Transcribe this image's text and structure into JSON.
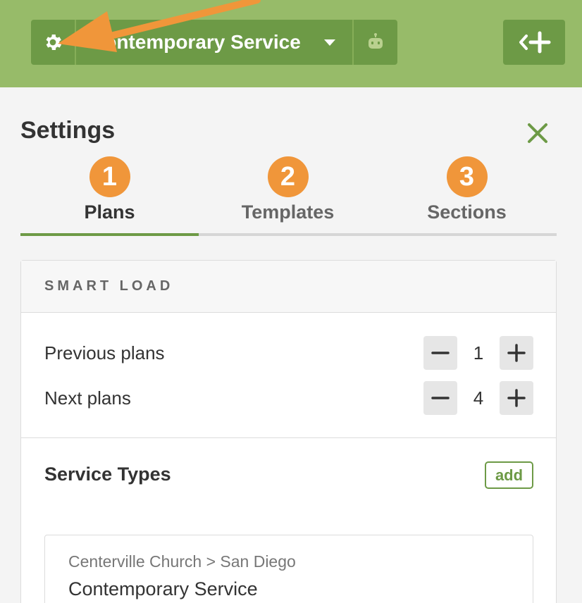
{
  "header": {
    "service_name": "Contemporary Service",
    "icons": {
      "settings": "gear-icon",
      "dropdown": "chevron-down-icon",
      "bot": "robot-icon",
      "collapse": "collapse-add-icon"
    },
    "colors": {
      "header_bg": "#97bb69",
      "button_bg": "#6d9a46",
      "annotation": "#f0963a"
    }
  },
  "settings": {
    "title": "Settings",
    "close_icon": "close-icon",
    "tabs": [
      {
        "number": "1",
        "label": "Plans",
        "active": true
      },
      {
        "number": "2",
        "label": "Templates",
        "active": false
      },
      {
        "number": "3",
        "label": "Sections",
        "active": false
      }
    ]
  },
  "smart_load": {
    "title": "SMART LOAD",
    "rows": [
      {
        "label": "Previous plans",
        "value": "1"
      },
      {
        "label": "Next plans",
        "value": "4"
      }
    ]
  },
  "service_types": {
    "title": "Service Types",
    "add_label": "add",
    "items": [
      {
        "path": "Centerville Church > San Diego",
        "name": "Contemporary Service"
      }
    ]
  }
}
